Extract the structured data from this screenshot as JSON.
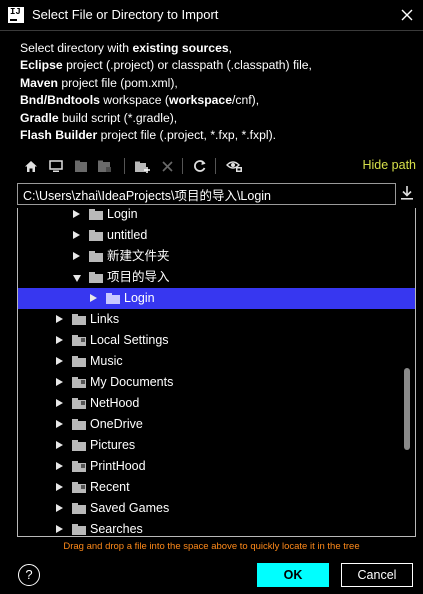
{
  "window": {
    "title": "Select File or Directory to Import",
    "icon": "intellij-app-icon",
    "icon_text": "IJ"
  },
  "description": {
    "lines": [
      [
        {
          "t": "Select directory with ",
          "b": false
        },
        {
          "t": "existing sources",
          "b": true
        },
        {
          "t": ",",
          "b": false
        }
      ],
      [
        {
          "t": "Eclipse",
          "b": true
        },
        {
          "t": " project (.project) or classpath (.classpath) file,",
          "b": false
        }
      ],
      [
        {
          "t": "Maven",
          "b": true
        },
        {
          "t": " project file (pom.xml),",
          "b": false
        }
      ],
      [
        {
          "t": "Bnd/Bndtools",
          "b": true
        },
        {
          "t": " workspace (",
          "b": false
        },
        {
          "t": "workspace",
          "b": true
        },
        {
          "t": "/cnf),",
          "b": false
        }
      ],
      [
        {
          "t": "Gradle",
          "b": true
        },
        {
          "t": " build script (*.gradle),",
          "b": false
        }
      ],
      [
        {
          "t": "Flash Builder",
          "b": true
        },
        {
          "t": " project file (.project, *.fxp, *.fxpl).",
          "b": false
        }
      ]
    ]
  },
  "toolbar": {
    "buttons": [
      {
        "icon": "home-icon",
        "enabled": true
      },
      {
        "icon": "desktop-icon",
        "enabled": true
      },
      {
        "icon": "project-folder-icon",
        "enabled": false
      },
      {
        "icon": "module-folder-icon",
        "enabled": false
      },
      {
        "icon": "new-folder-icon",
        "enabled": true
      },
      {
        "icon": "delete-icon",
        "enabled": false
      },
      {
        "icon": "refresh-icon",
        "enabled": true
      },
      {
        "icon": "show-hidden-icon",
        "enabled": true
      }
    ],
    "hide_path_label": "Hide path"
  },
  "path": {
    "value": "C:\\Users\\zhai\\IdeaProjects\\项目的导入\\Login"
  },
  "tree": {
    "rows": [
      {
        "label": "Login",
        "depth": 4,
        "expanded": false,
        "selected": false,
        "special": false
      },
      {
        "label": "untitled",
        "depth": 4,
        "expanded": false,
        "selected": false,
        "special": false
      },
      {
        "label": "新建文件夹",
        "depth": 4,
        "expanded": false,
        "selected": false,
        "special": false
      },
      {
        "label": "项目的导入",
        "depth": 4,
        "expanded": true,
        "selected": false,
        "special": false
      },
      {
        "label": "Login",
        "depth": 5,
        "expanded": false,
        "selected": true,
        "special": false
      },
      {
        "label": "Links",
        "depth": 3,
        "expanded": false,
        "selected": false,
        "special": false
      },
      {
        "label": "Local Settings",
        "depth": 3,
        "expanded": false,
        "selected": false,
        "special": true
      },
      {
        "label": "Music",
        "depth": 3,
        "expanded": false,
        "selected": false,
        "special": false
      },
      {
        "label": "My Documents",
        "depth": 3,
        "expanded": false,
        "selected": false,
        "special": true
      },
      {
        "label": "NetHood",
        "depth": 3,
        "expanded": false,
        "selected": false,
        "special": true
      },
      {
        "label": "OneDrive",
        "depth": 3,
        "expanded": false,
        "selected": false,
        "special": false
      },
      {
        "label": "Pictures",
        "depth": 3,
        "expanded": false,
        "selected": false,
        "special": false
      },
      {
        "label": "PrintHood",
        "depth": 3,
        "expanded": false,
        "selected": false,
        "special": true
      },
      {
        "label": "Recent",
        "depth": 3,
        "expanded": false,
        "selected": false,
        "special": true
      },
      {
        "label": "Saved Games",
        "depth": 3,
        "expanded": false,
        "selected": false,
        "special": false
      },
      {
        "label": "Searches",
        "depth": 3,
        "expanded": false,
        "selected": false,
        "special": false
      }
    ]
  },
  "hint": "Drag and drop a file into the space above to quickly locate it in the tree",
  "footer": {
    "help_label": "?",
    "ok_label": "OK",
    "cancel_label": "Cancel"
  },
  "colors": {
    "background": "#000000",
    "selection": "#3737f0",
    "ok_button": "#00ffff",
    "hint_text": "#ff8a1a",
    "link": "#d7e04a"
  }
}
